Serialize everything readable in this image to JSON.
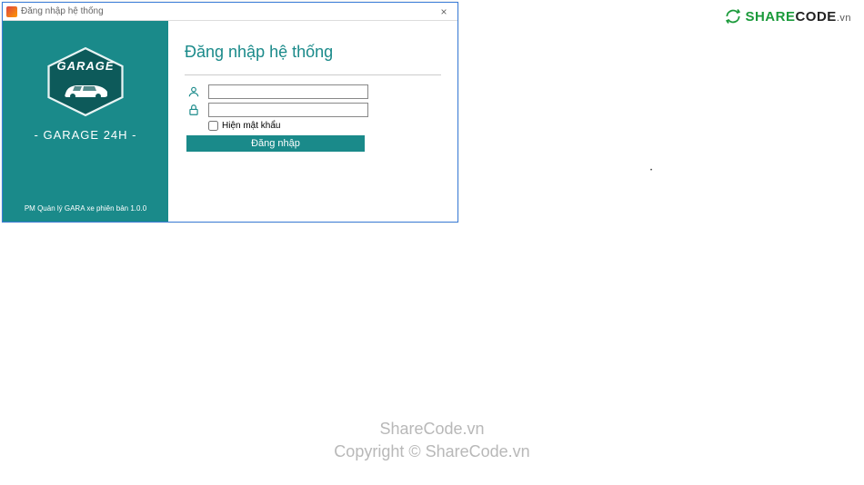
{
  "window": {
    "title": "Đăng nhập hệ thống"
  },
  "sidebar": {
    "logo_label": "GARAGE",
    "brand": "- GARAGE 24H -",
    "version": "PM Quản lý GARA xe phiên bản 1.0.0"
  },
  "form": {
    "heading": "Đăng nhập hệ thống",
    "username_value": "",
    "password_value": "",
    "show_password_label": "Hiện mật khẩu",
    "submit_label": "Đăng nhập"
  },
  "watermark": {
    "share": "SHARE",
    "code": "CODE",
    "vn": ".vn",
    "line1": "ShareCode.vn",
    "line2": "Copyright © ShareCode.vn"
  },
  "colors": {
    "accent": "#1a8a8a",
    "green": "#1a9a3a"
  }
}
